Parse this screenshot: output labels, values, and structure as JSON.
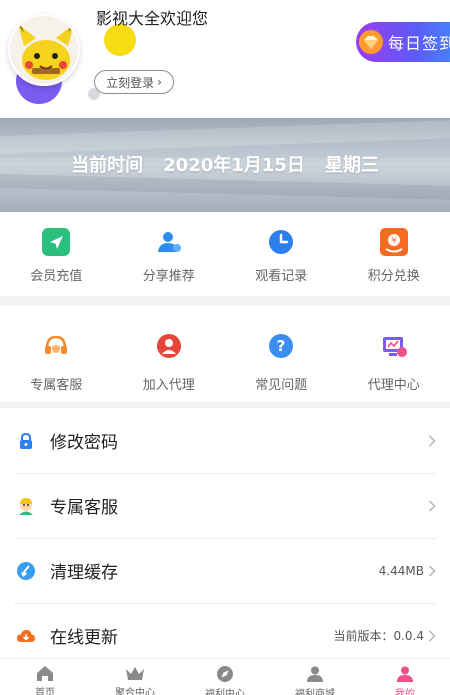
{
  "header": {
    "welcome_text": "影视大全欢迎您",
    "login_label": "立刻登录",
    "checkin_label": "每日签到"
  },
  "banner": {
    "time_label": "当前时间",
    "date": "2020年1月15日",
    "weekday": "星期三"
  },
  "grid_primary": [
    {
      "label": "会员充值",
      "icon": "send-icon",
      "color": "#2bbf7e"
    },
    {
      "label": "分享推荐",
      "icon": "user-share-icon",
      "color": "#2d8cf0"
    },
    {
      "label": "观看记录",
      "icon": "clock-icon",
      "color": "#2d7ff0"
    },
    {
      "label": "积分兑换",
      "icon": "coin-exchange-icon",
      "color": "#f56b1f"
    }
  ],
  "grid_secondary": [
    {
      "label": "专属客服",
      "icon": "headset-icon",
      "color": "#f58a2c"
    },
    {
      "label": "加入代理",
      "icon": "agent-icon",
      "color": "#e8463a"
    },
    {
      "label": "常见问题",
      "icon": "question-icon",
      "color": "#3a8ef0"
    },
    {
      "label": "代理中心",
      "icon": "agent-center-icon",
      "color": "#7a5cf0"
    }
  ],
  "settings": [
    {
      "label": "修改密码",
      "icon": "lock-icon",
      "right_text": ""
    },
    {
      "label": "专属客服",
      "icon": "support-avatar-icon",
      "right_text": ""
    },
    {
      "label": "清理缓存",
      "icon": "broom-icon",
      "right_text": "4.44MB"
    },
    {
      "label": "在线更新",
      "icon": "cloud-download-icon",
      "right_text": "当前版本：0.0.4"
    }
  ],
  "nav": {
    "active_color": "#f0508a",
    "items": [
      {
        "label": "首页",
        "icon": "home-icon"
      },
      {
        "label": "聚合中心",
        "icon": "crown-icon"
      },
      {
        "label": "福利中心",
        "icon": "compass-icon"
      },
      {
        "label": "福利商城",
        "icon": "user-icon"
      },
      {
        "label": "我的",
        "icon": "profile-icon",
        "active": true
      }
    ]
  }
}
